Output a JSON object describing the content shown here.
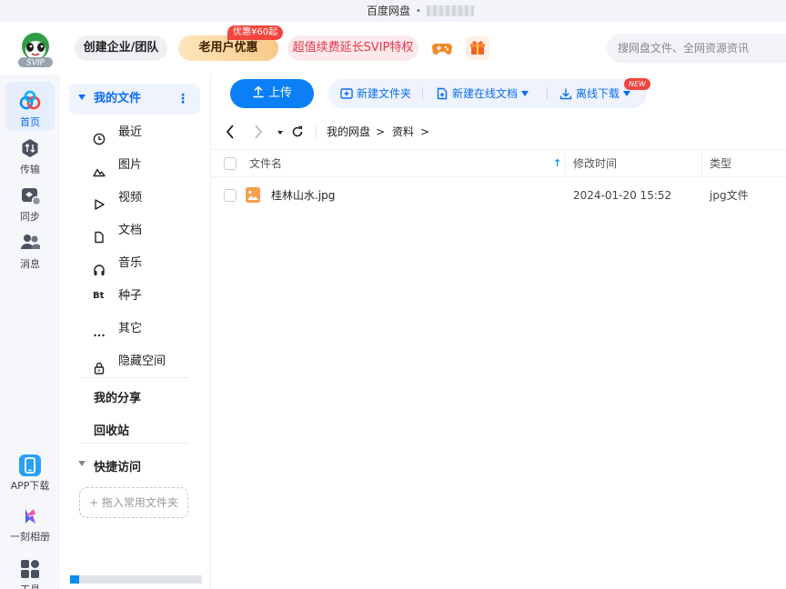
{
  "window": {
    "title": "百度网盘"
  },
  "header": {
    "logo_text": "SVIP",
    "enterprise_label": "创建企业/团队",
    "old_user_label": "老用户优惠",
    "discount_badge": "优惠¥60起",
    "svip_label": "超值续费延长SVIP特权",
    "search_placeholder": "搜网盘文件、全网资源资讯"
  },
  "leftnav": {
    "items": [
      {
        "label": "首页",
        "icon": "home-icon",
        "active": true
      },
      {
        "label": "传输",
        "icon": "transfer-icon"
      },
      {
        "label": "同步",
        "icon": "sync-icon"
      },
      {
        "label": "消息",
        "icon": "message-icon"
      }
    ],
    "bottom": [
      {
        "label": "APP下载",
        "icon": "phone-icon"
      },
      {
        "label": "一刻相册",
        "icon": "album-icon"
      },
      {
        "label": "工具",
        "icon": "apps-icon"
      }
    ]
  },
  "sidebar": {
    "my_files": "我的文件",
    "items": [
      {
        "label": "最近",
        "icon": "clock-icon"
      },
      {
        "label": "图片",
        "icon": "image-icon"
      },
      {
        "label": "视频",
        "icon": "play-icon"
      },
      {
        "label": "文档",
        "icon": "document-icon"
      },
      {
        "label": "音乐",
        "icon": "headphones-icon"
      },
      {
        "label": "种子",
        "icon": "bt-icon"
      },
      {
        "label": "其它",
        "icon": "more-icon"
      },
      {
        "label": "隐藏空间",
        "icon": "lock-icon"
      }
    ],
    "my_share": "我的分享",
    "recycle": "回收站",
    "quick_access": "快捷访问",
    "add_folder": "+ 拖入常用文件夹",
    "storage_used_fraction": 0.07
  },
  "toolbar": {
    "upload": "上传",
    "new_folder": "新建文件夹",
    "new_online_doc": "新建在线文档",
    "new_badge": "NEW",
    "offline_download": "离线下载"
  },
  "breadcrumb": [
    "我的网盘",
    "资料"
  ],
  "table": {
    "columns": {
      "name": "文件名",
      "modified": "修改时间",
      "type": "类型"
    },
    "rows": [
      {
        "name": "桂林山水.jpg",
        "modified": "2024-01-20 15:52",
        "type": "jpg文件"
      }
    ]
  },
  "colors": {
    "accent": "#0b6cf5",
    "upload": "#0b7ff5",
    "red_badge": "#f2453d",
    "svip_text": "#e8374b"
  }
}
